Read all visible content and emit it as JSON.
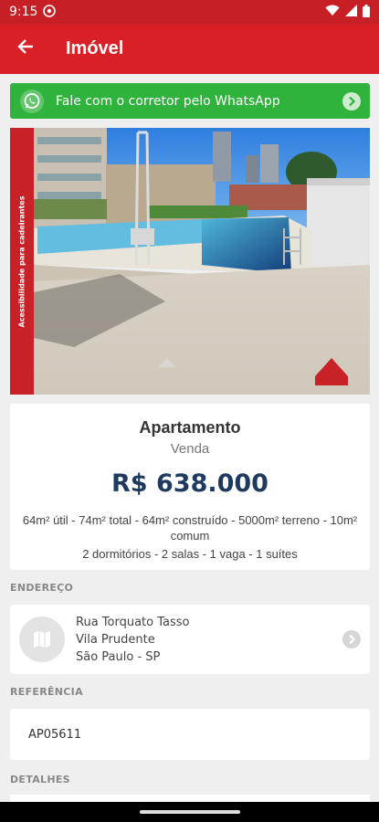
{
  "status_bar": {
    "time": "9:15"
  },
  "app_bar": {
    "title": "Imóvel"
  },
  "whatsapp": {
    "label": "Fale com o corretor pelo WhatsApp"
  },
  "photo": {
    "ribbon_text": "Acessibilidade para cadeirantes"
  },
  "summary": {
    "type": "Apartamento",
    "deal": "Venda",
    "price": "R$ 638.000",
    "areas": "64m² útil - 74m² total - 64m² construído - 5000m² terreno - 10m² comum",
    "rooms": "2 dormitórios - 2 salas - 1 vaga - 1 suítes"
  },
  "sections": {
    "address_label": "ENDEREÇO",
    "reference_label": "REFERÊNCIA",
    "details_label": "DETALHES"
  },
  "address": {
    "street": "Rua Torquato Tasso",
    "district": "Vila Prudente",
    "city": "São Paulo - SP"
  },
  "reference": {
    "code": "AP05611"
  },
  "colors": {
    "primary": "#d92027",
    "whatsapp": "#2fb33c",
    "price": "#1e3a5f"
  }
}
